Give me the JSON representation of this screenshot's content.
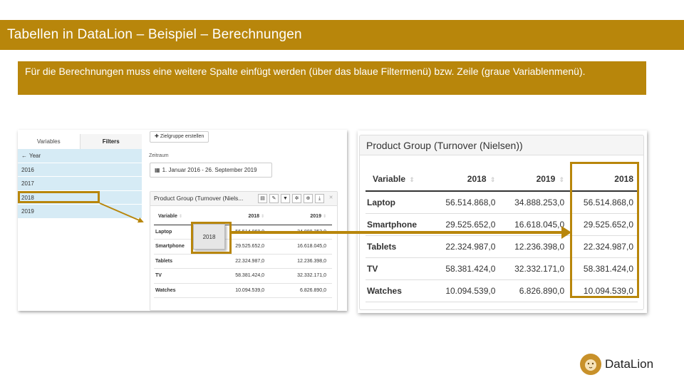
{
  "slide": {
    "title": "Tabellen in DataLion – Beispiel – Berechnungen",
    "note": "Für die Berechnungen muss eine weitere Spalte einfügt werden (über das blaue Filtermenü) bzw. Zeile (graue Variablenmenü)."
  },
  "left_shot": {
    "tabs": {
      "variables": "Variables",
      "filters": "Filters"
    },
    "year_header": "Year",
    "years": [
      "2016",
      "2017",
      "2018",
      "2019"
    ],
    "target_group_button": "Zielgruppe erstellen",
    "period_label": "Zeitraum",
    "period_value": "1. Januar 2016 - 26. September 2019",
    "card_title": "Product Group (Turnover (Niels...",
    "columns": [
      "Variable",
      "2018",
      "2019"
    ],
    "rows": [
      {
        "variable": "Laptop",
        "v2018": "56.514.868,0",
        "v2019": "34.888.253,0"
      },
      {
        "variable": "Smartphone",
        "v2018": "29.525.652,0",
        "v2019": "16.618.045,0"
      },
      {
        "variable": "Tablets",
        "v2018": "22.324.987,0",
        "v2019": "12.236.398,0"
      },
      {
        "variable": "TV",
        "v2018": "58.381.424,0",
        "v2019": "32.332.171,0"
      },
      {
        "variable": "Watches",
        "v2018": "10.094.539,0",
        "v2019": "6.826.890,0"
      }
    ],
    "drag_chip": "2018"
  },
  "right_shot": {
    "title": "Product Group (Turnover (Nielsen))",
    "columns": [
      "Variable",
      "2018",
      "2019",
      "2018"
    ],
    "rows": [
      {
        "variable": "Laptop",
        "c1": "56.514.868,0",
        "c2": "34.888.253,0",
        "c3": "56.514.868,0"
      },
      {
        "variable": "Smartphone",
        "c1": "29.525.652,0",
        "c2": "16.618.045,0",
        "c3": "29.525.652,0"
      },
      {
        "variable": "Tablets",
        "c1": "22.324.987,0",
        "c2": "12.236.398,0",
        "c3": "22.324.987,0"
      },
      {
        "variable": "TV",
        "c1": "58.381.424,0",
        "c2": "32.332.171,0",
        "c3": "58.381.424,0"
      },
      {
        "variable": "Watches",
        "c1": "10.094.539,0",
        "c2": "6.826.890,0",
        "c3": "10.094.539,0"
      }
    ]
  },
  "logo": {
    "text": "DataLion"
  },
  "colors": {
    "accent": "#b8860b",
    "filter_blue": "#d6ebf5"
  }
}
